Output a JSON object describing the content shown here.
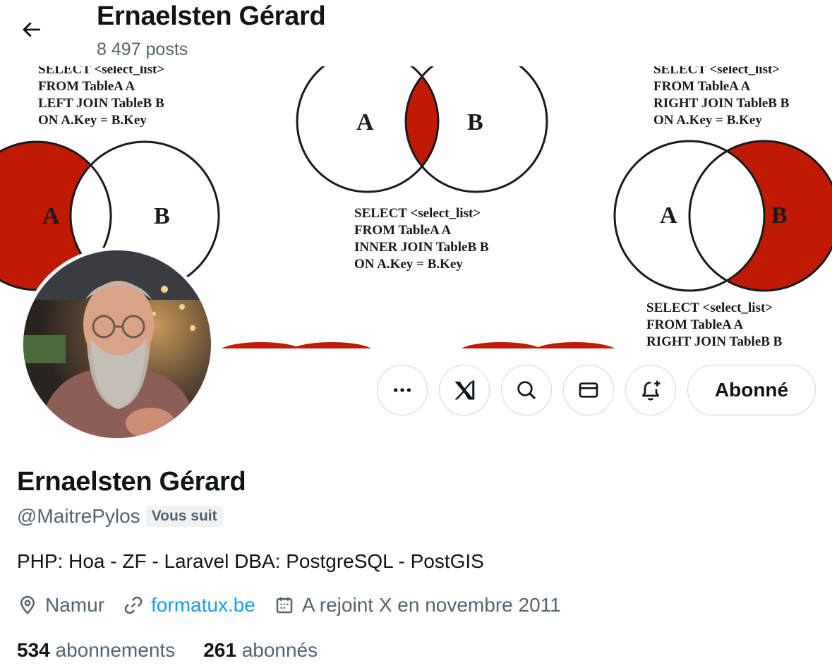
{
  "header": {
    "title": "Ernaelsten Gérard",
    "posts": "8 497 posts"
  },
  "banner": {
    "top_left_sql": [
      "SELECT <select_list>",
      "FROM TableA A",
      "LEFT JOIN TableB B",
      "ON A.Key = B.Key"
    ],
    "center_sql": [
      "SELECT <select_list>",
      "FROM TableA A",
      "INNER JOIN TableB B",
      "ON A.Key = B.Key"
    ],
    "top_right_sql": [
      "SELECT <select_list>",
      "FROM TableA A",
      "RIGHT JOIN TableB B",
      "ON A.Key = B.Key"
    ],
    "bottom_right_sql": [
      "SELECT <select_list>",
      "FROM TableA A",
      "RIGHT JOIN TableB B"
    ],
    "label_a": "A",
    "label_b": "B",
    "highlight_color": "#c01a05"
  },
  "actions": {
    "follow_label": "Abonné"
  },
  "profile": {
    "name": "Ernaelsten Gérard",
    "handle": "@MaitrePylos",
    "follows_you": "Vous suit",
    "bio": "PHP: Hoa - ZF - Laravel DBA: PostgreSQL - PostGIS",
    "location": "Namur",
    "website": "formatux.be",
    "joined": "A rejoint X en novembre 2011"
  },
  "stats": {
    "following_count": "534",
    "following_label": "abonnements",
    "followers_count": "261",
    "followers_label": "abonnés"
  },
  "colors": {
    "text": "#0f1419",
    "muted": "#536471",
    "link": "#1d9bf0",
    "border": "#cfd9de"
  }
}
